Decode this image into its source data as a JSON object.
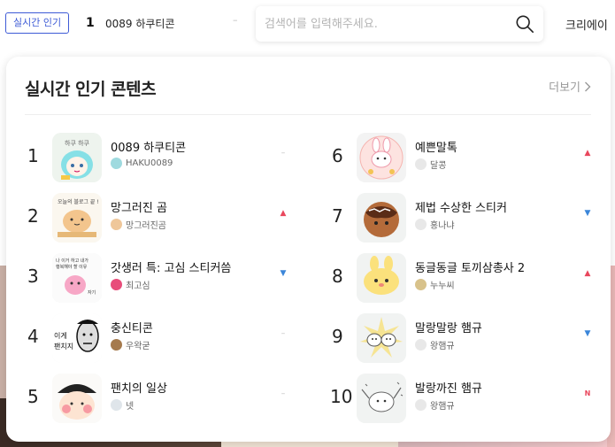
{
  "header": {
    "badge": "실시간 인기",
    "top_rank": "1",
    "top_title": "0089 하쿠티콘",
    "top_trend": "–",
    "search_placeholder": "검색어를 입력해주세요.",
    "creator_link": "크리에이"
  },
  "panel": {
    "title": "실시간 인기 콘텐츠",
    "more_label": "더보기"
  },
  "colors": {
    "accent": "#3e5bd6",
    "up": "#e9475d",
    "down": "#3b86d9",
    "same": "#bbbbbb"
  },
  "items": [
    {
      "rank": "1",
      "title": "0089 하쿠티콘",
      "creator": "HAKU0089",
      "trend": "–",
      "trend_type": "same",
      "thumb_icon": "haku-character-icon"
    },
    {
      "rank": "2",
      "title": "망그러진 곰",
      "creator": "망그러진곰",
      "trend": "▲",
      "trend_type": "up",
      "thumb_icon": "bear-character-icon"
    },
    {
      "rank": "3",
      "title": "갓생러 특: 고심 스티커씀",
      "creator": "최고심",
      "trend": "▼",
      "trend_type": "down",
      "thumb_icon": "pink-blob-icon"
    },
    {
      "rank": "4",
      "title": "충신티콘",
      "creator": "우왁굳",
      "trend": "–",
      "trend_type": "same",
      "thumb_icon": "comic-face-icon"
    },
    {
      "rank": "5",
      "title": "팬치의 일상",
      "creator": "넷",
      "trend": "–",
      "trend_type": "same",
      "thumb_icon": "blush-face-icon"
    },
    {
      "rank": "6",
      "title": "예쁜말톡",
      "creator": "달콩",
      "trend": "▲",
      "trend_type": "up",
      "thumb_icon": "bunny-icon"
    },
    {
      "rank": "7",
      "title": "제법 수상한 스티커",
      "creator": "홍나냐",
      "trend": "▼",
      "trend_type": "down",
      "thumb_icon": "takoyaki-icon"
    },
    {
      "rank": "8",
      "title": "동글동글 토끼삼총사 2",
      "creator": "누누씨",
      "trend": "▲",
      "trend_type": "up",
      "thumb_icon": "yellow-rabbit-icon"
    },
    {
      "rank": "9",
      "title": "말랑말랑 햄규",
      "creator": "왕햄규",
      "trend": "▼",
      "trend_type": "down",
      "thumb_icon": "hamster-icon"
    },
    {
      "rank": "10",
      "title": "발랑까진 햄규",
      "creator": "왕햄규",
      "trend": "N",
      "trend_type": "new",
      "thumb_icon": "hamster-wave-icon"
    }
  ]
}
